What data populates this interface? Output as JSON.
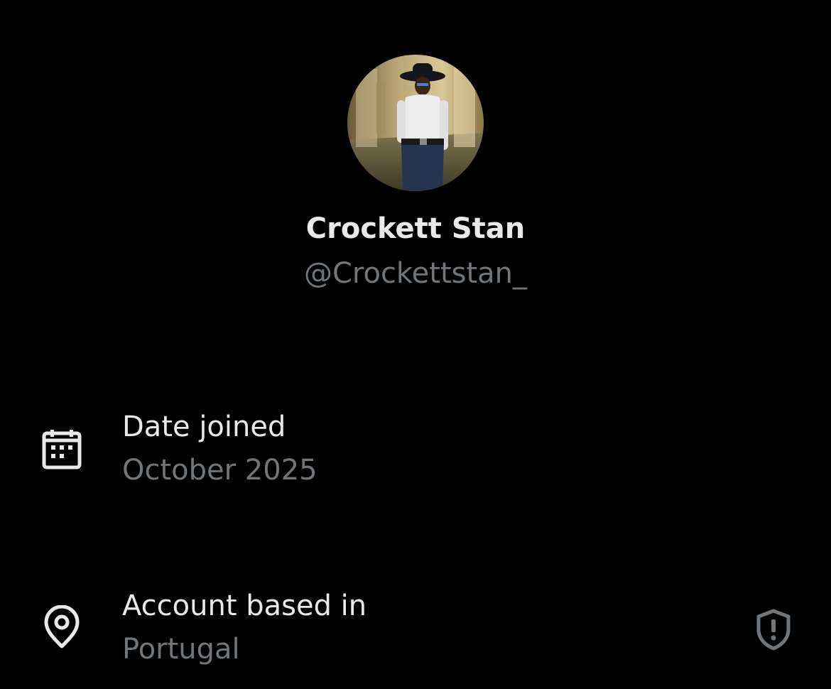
{
  "profile": {
    "display_name": "Crockett Stan",
    "handle": "@Crockettstan_"
  },
  "about": {
    "date_joined": {
      "label": "Date joined",
      "value": "October 2025",
      "icon": "calendar-icon"
    },
    "account_based_in": {
      "label": "Account based in",
      "value": "Portugal",
      "icon": "location-pin-icon",
      "trailing_icon": "shield-alert-icon"
    }
  },
  "colors": {
    "background": "#000000",
    "primary_text": "#e7e9ea",
    "secondary_text": "#71767b"
  }
}
